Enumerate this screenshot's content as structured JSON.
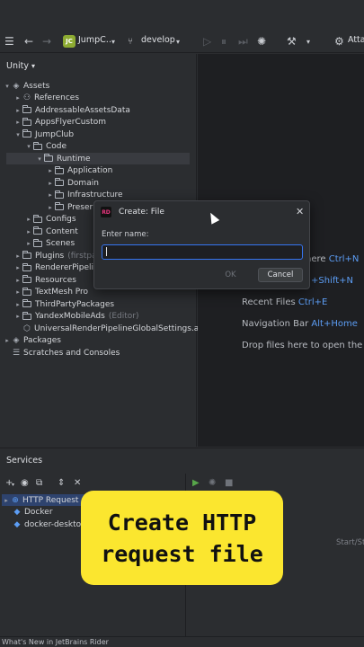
{
  "toolbar": {
    "project_badge": "JC",
    "project_name": "JumpC…",
    "branch": "develop",
    "attach": "Atta"
  },
  "unity_panel": {
    "title": "Unity",
    "tree": [
      {
        "label": "Assets",
        "arrow": "▾",
        "icon": "unity-icon",
        "indent": 0
      },
      {
        "label": "References",
        "arrow": "▸",
        "icon": "references-icon",
        "indent": 1
      },
      {
        "label": "AddressableAssetsData",
        "arrow": "▸",
        "icon": "folder-icon",
        "indent": 1
      },
      {
        "label": "AppsFlyerCustom",
        "arrow": "▸",
        "icon": "folder-icon",
        "indent": 1
      },
      {
        "label": "JumpClub",
        "arrow": "▾",
        "icon": "folder-icon",
        "indent": 1
      },
      {
        "label": "Code",
        "arrow": "▾",
        "icon": "folder-icon",
        "indent": 2
      },
      {
        "label": "Runtime",
        "arrow": "▾",
        "icon": "folder-icon",
        "indent": 3,
        "selected": true
      },
      {
        "label": "Application",
        "arrow": "▸",
        "icon": "folder-icon",
        "indent": 4
      },
      {
        "label": "Domain",
        "arrow": "▸",
        "icon": "folder-icon",
        "indent": 4
      },
      {
        "label": "Infrastructure",
        "arrow": "▸",
        "icon": "folder-icon",
        "indent": 4
      },
      {
        "label": "Preser",
        "arrow": "▸",
        "icon": "folder-icon",
        "indent": 4
      },
      {
        "label": "Configs",
        "arrow": "▸",
        "icon": "folder-icon",
        "indent": 2
      },
      {
        "label": "Content",
        "arrow": "▸",
        "icon": "folder-icon",
        "indent": 2
      },
      {
        "label": "Scenes",
        "arrow": "▸",
        "icon": "folder-icon",
        "indent": 2
      },
      {
        "label": "Plugins",
        "arrow": "▸",
        "icon": "folder-icon",
        "indent": 1,
        "suffix": "(firstpa"
      },
      {
        "label": "RendererPipelin",
        "arrow": "▸",
        "icon": "folder-icon",
        "indent": 1
      },
      {
        "label": "Resources",
        "arrow": "▸",
        "icon": "folder-icon",
        "indent": 1
      },
      {
        "label": "TextMesh Pro",
        "arrow": "▸",
        "icon": "folder-icon",
        "indent": 1
      },
      {
        "label": "ThirdPartyPackages",
        "arrow": "▸",
        "icon": "folder-icon",
        "indent": 1
      },
      {
        "label": "YandexMobileAds",
        "arrow": "▸",
        "icon": "folder-icon",
        "indent": 1,
        "suffix": "(Editor)"
      },
      {
        "label": "UniversalRenderPipelineGlobalSettings.ass",
        "arrow": "",
        "icon": "asset-file-icon",
        "indent": 1
      },
      {
        "label": "Packages",
        "arrow": "▸",
        "icon": "packages-icon",
        "indent": 0
      },
      {
        "label": "Scratches and Consoles",
        "arrow": "",
        "icon": "scratches-icon",
        "indent": 0
      }
    ]
  },
  "editor_tips": [
    {
      "text": "here",
      "shortcut": "Ctrl+N"
    },
    {
      "text": "",
      "shortcut": "+Shift+N"
    },
    {
      "text": "Recent Files",
      "shortcut": "Ctrl+E"
    },
    {
      "text": "Navigation Bar",
      "shortcut": "Alt+Home"
    },
    {
      "text": "Drop files here to open the",
      "shortcut": ""
    }
  ],
  "services": {
    "title": "Services",
    "items": [
      {
        "label": "HTTP Request",
        "selected": true
      },
      {
        "label": "Docker",
        "selected": false
      },
      {
        "label": "docker-deskto",
        "selected": false
      }
    ],
    "right_text": "Start/St"
  },
  "dialog": {
    "title": "Create: File",
    "name_label": "Enter name:",
    "name_value": "",
    "ok_label": "OK",
    "cancel_label": "Cancel"
  },
  "caption": {
    "line1": "Create HTTP",
    "line2": "request file"
  },
  "status_bar": {
    "text": "What's New in JetBrains Rider"
  },
  "colors": {
    "accent": "#3574f0",
    "caption_bg": "#fbe62f",
    "panel_bg": "#2b2d30",
    "editor_bg": "#1e1f22"
  }
}
